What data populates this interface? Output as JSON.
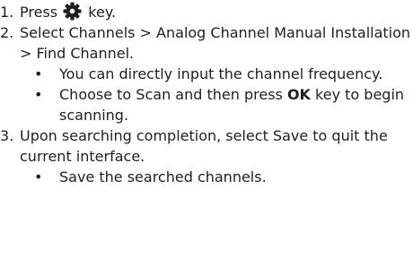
{
  "steps": [
    {
      "number": "1.",
      "before_icon": "Press",
      "icon": "gear-icon",
      "after_icon": "key."
    },
    {
      "number": "2.",
      "text": "Select Channels > Analog Channel Manual Installation > Find Channel.",
      "bullets": [
        {
          "text": "You can directly input the channel frequency."
        },
        {
          "text_before": "Choose to Scan and then press",
          "bold": "OK",
          "text_after": "key to begin scanning."
        }
      ]
    },
    {
      "number": "3.",
      "text": "Upon searching completion, select Save to quit the current interface.",
      "bullets": [
        {
          "text": "Save the searched channels."
        }
      ]
    }
  ],
  "bullet_glyph": "•"
}
